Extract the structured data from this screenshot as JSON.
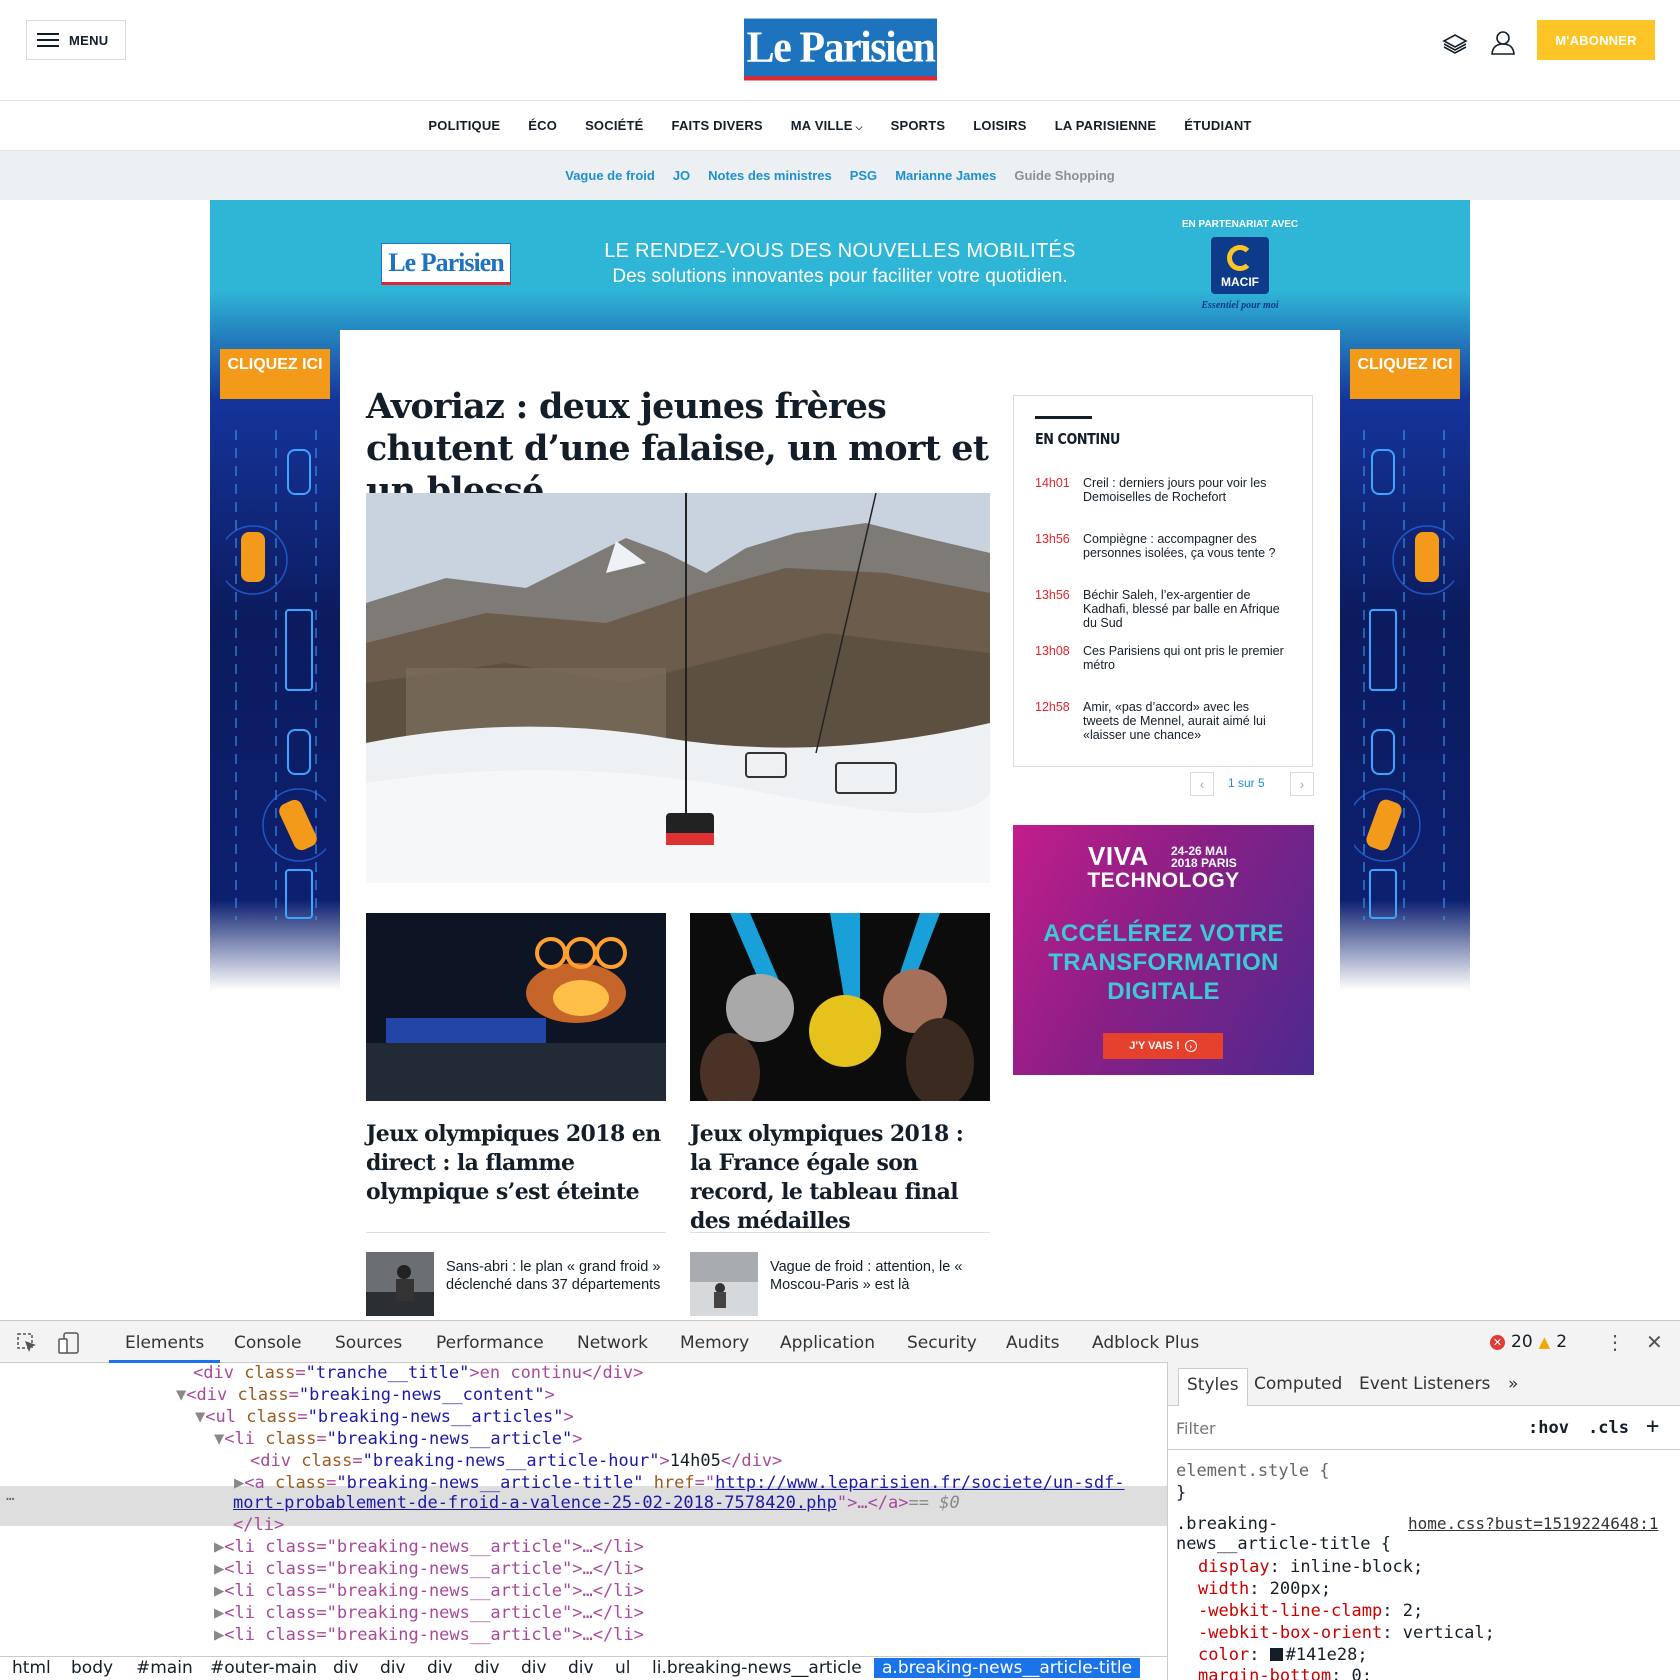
{
  "header": {
    "menu_label": "MENU",
    "logo_text": "Le Parisien",
    "subscribe_label": "M'ABONNER",
    "icons": [
      "newspaper-icon",
      "user-icon"
    ]
  },
  "nav": {
    "items": [
      "POLITIQUE",
      "ÉCO",
      "SOCIÉTÉ",
      "FAITS DIVERS",
      "MA VILLE",
      "SPORTS",
      "LOISIRS",
      "LA PARISIENNE",
      "ÉTUDIANT"
    ]
  },
  "trending": {
    "items": [
      "Vague de froid",
      "JO",
      "Notes des ministres",
      "PSG",
      "Marianne James",
      "Guide Shopping"
    ]
  },
  "ad": {
    "logo_text": "Le Parisien",
    "line1": "LE RENDEZ-VOUS DES NOUVELLES MOBILITÉS",
    "line2": "Des solutions innovantes pour faciliter votre quotidien.",
    "partner_label": "EN PARTENARIAT AVEC",
    "partner_name": "MACIF",
    "partner_tagline": "Essentiel pour moi",
    "cta_left": "CLIQUEZ ICI",
    "cta_right": "CLIQUEZ ICI"
  },
  "main": {
    "headline": "Avoriaz : deux jeunes frères chutent d’une falaise, un mort et un blessé",
    "cards": [
      {
        "title": "Jeux olympiques 2018 en direct : la flamme olympique s’est éteinte"
      },
      {
        "title": "Jeux olympiques 2018 : la France égale son record, le tableau final des médailles"
      }
    ],
    "minis": [
      {
        "text": "Sans-abri : le plan « grand froid » déclenché dans 37 départements"
      },
      {
        "text": "Vague de froid : attention, le « Moscou-Paris » est là"
      }
    ]
  },
  "continu": {
    "heading": "EN CONTINU",
    "items": [
      {
        "hour": "14h01",
        "text": "Creil : derniers jours pour voir les Demoiselles de Rochefort"
      },
      {
        "hour": "13h56",
        "text": "Compiègne : accompagner des personnes isolées, ça vous tente ?"
      },
      {
        "hour": "13h56",
        "text": "Béchir Saleh, l’ex-argentier de Kadhafi, blessé par balle en Afrique du Sud"
      },
      {
        "hour": "13h08",
        "text": "Ces Parisiens qui ont pris le premier métro"
      },
      {
        "hour": "12h58",
        "text": "Amir, «pas d’accord» avec les tweets de Mennel, aurait aimé lui «laisser une chance»"
      }
    ],
    "pager": "1 sur 5"
  },
  "viva": {
    "brand1": "VIVA",
    "dates": "24-26 MAI",
    "city": "2018 PARIS",
    "brand2": "TECHNOLOGY",
    "line1": "ACCÉLÉREZ VOTRE",
    "line2": "TRANSFORMATION",
    "line3": "DIGITALE",
    "cta": "J'Y VAIS !"
  },
  "devtools": {
    "tabs": [
      "Elements",
      "Console",
      "Sources",
      "Performance",
      "Network",
      "Memory",
      "Application",
      "Security",
      "Audits",
      "Adblock Plus"
    ],
    "errors": "20",
    "warnings": "2",
    "dom": {
      "l1_tag_open": "<div ",
      "l1_attr": "class",
      "l1_val": "\"tranche__title\"",
      "l1_text": ">en continu</div>",
      "l2_val": "\"breaking-news__content\"",
      "l3_val": "\"breaking-news__articles\"",
      "l4_val": "\"breaking-news__article\"",
      "l5_val": "\"breaking-news__article-hour\"",
      "l5_text": "14h05",
      "l6_val": "\"breaking-news__article-title\"",
      "l6_href_attr": "href",
      "l6_href": "http://www.leparisien.fr/societe/un-sdf-",
      "l6_href2": "mort-probablement-de-froid-a-valence-25-02-2018-7578420.php",
      "l6_tail": "== $0",
      "collapsed": "<li class=\"breaking-news__article\">…</li>"
    },
    "breadcrumbs": [
      "html",
      "body",
      "#main",
      "#outer-main",
      "div",
      "div",
      "div",
      "div",
      "div",
      "div",
      "ul",
      "li.breaking-news__article",
      "a.breaking-news__article-title"
    ],
    "side_tabs": [
      "Styles",
      "Computed",
      "Event Listeners"
    ],
    "filter_placeholder": "Filter",
    "hov": ":hov",
    "cls": ".cls",
    "styles": {
      "element_style": "element.style {",
      "close": "}",
      "selector1": ".breaking-",
      "selector2": "news__article-title {",
      "source": "home.css?bust=1519224648:1",
      "props": [
        {
          "name": "display",
          "value": "inline-block;"
        },
        {
          "name": "width",
          "value": "200px;"
        },
        {
          "name": "-webkit-line-clamp",
          "value": "2;"
        },
        {
          "name": "-webkit-box-orient",
          "value": "vertical;"
        },
        {
          "name": "color",
          "value": "#141e28;"
        },
        {
          "name": "margin-bottom",
          "value": "0;"
        }
      ]
    }
  }
}
